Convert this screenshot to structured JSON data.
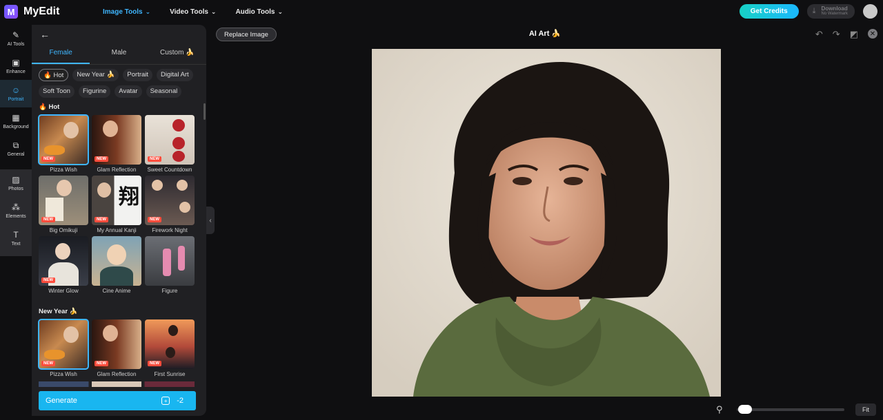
{
  "app": {
    "logo_letter": "M",
    "name": "MyEdit"
  },
  "nav": [
    {
      "label": "Image Tools",
      "active": true
    },
    {
      "label": "Video Tools",
      "active": false
    },
    {
      "label": "Audio Tools",
      "active": false
    }
  ],
  "header": {
    "credits_label": "Get Credits",
    "download_label": "Download",
    "download_sub": "No Watermark"
  },
  "rail": [
    {
      "label": "AI Tools",
      "icon": "magic-wand-icon",
      "glyph": "✎"
    },
    {
      "label": "Enhance",
      "icon": "enhance-image-icon",
      "glyph": "▣"
    },
    {
      "label": "Portrait",
      "icon": "portrait-icon",
      "glyph": "☺",
      "active": true
    },
    {
      "label": "Background",
      "icon": "background-icon",
      "glyph": "▦"
    },
    {
      "label": "General",
      "icon": "general-icon",
      "glyph": "⧉"
    }
  ],
  "rail_group": [
    {
      "label": "Photos",
      "icon": "photos-icon",
      "glyph": "▨"
    },
    {
      "label": "Elements",
      "icon": "elements-icon",
      "glyph": "⁂"
    },
    {
      "label": "Text",
      "icon": "text-icon",
      "glyph": "T"
    }
  ],
  "panel": {
    "tabs": [
      {
        "label": "Female",
        "active": true
      },
      {
        "label": "Male",
        "active": false
      },
      {
        "label": "Custom 🍌",
        "active": false
      }
    ],
    "chips": [
      "🔥 Hot",
      "New Year 🍌",
      "Portrait",
      "Digital Art",
      "Soft Toon",
      "Figurine",
      "Avatar",
      "Seasonal"
    ],
    "hot_title": "🔥 Hot",
    "hot_items": [
      {
        "label": "Pizza Wish",
        "badge": "NEW"
      },
      {
        "label": "Glam Reflection",
        "badge": "NEW"
      },
      {
        "label": "Sweet Countdown",
        "badge": "NEW"
      },
      {
        "label": "Big Omikuji",
        "badge": "NEW"
      },
      {
        "label": "My Annual Kanji",
        "badge": "NEW",
        "kanji": "翔"
      },
      {
        "label": "Firework Night",
        "badge": "NEW"
      },
      {
        "label": "Winter Glow",
        "badge": "NEW"
      },
      {
        "label": "Cine Anime",
        "badge": ""
      },
      {
        "label": "Figure",
        "badge": ""
      }
    ],
    "newyear_title": "New Year 🍌",
    "newyear_items": [
      {
        "label": "Pizza Wish",
        "badge": "NEW"
      },
      {
        "label": "Glam Reflection",
        "badge": "NEW"
      },
      {
        "label": "First Sunrise",
        "badge": "NEW"
      }
    ],
    "generate_label": "Generate",
    "generate_cost": "-2"
  },
  "canvas": {
    "replace_label": "Replace Image",
    "title": "AI Art 🍌",
    "fit_label": "Fit",
    "zoom_level": 0.05
  },
  "colors": {
    "accent": "#3fb6ff",
    "badge": "#ff4d3d",
    "generate": "#19b6f0"
  }
}
